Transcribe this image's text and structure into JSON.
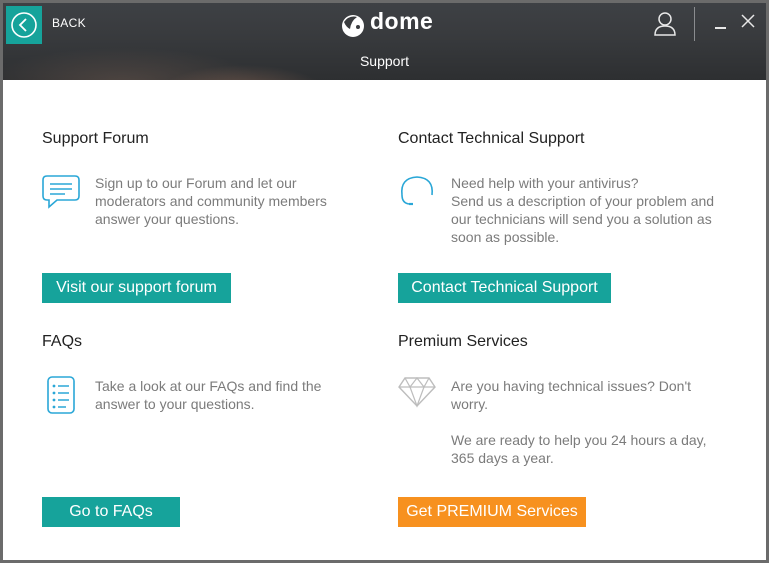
{
  "header": {
    "back_label": "BACK",
    "logo_text": "dome",
    "page_title": "Support"
  },
  "sections": {
    "forum": {
      "title": "Support Forum",
      "description": "Sign up to our Forum and let our moderators and community members answer your questions.",
      "button_label": "Visit our support forum",
      "icon": "chat-bubble-icon"
    },
    "contact": {
      "title": "Contact Technical Support",
      "description_line1": "Need help with your antivirus?",
      "description_line2": "Send us a description of your problem and our technicians will send you a solution as soon as possible.",
      "button_label": "Contact Technical Support",
      "icon": "headset-icon"
    },
    "faqs": {
      "title": "FAQs",
      "description": "Take a look at our FAQs and find the answer to your questions.",
      "button_label": "Go to FAQs",
      "icon": "faq-list-icon"
    },
    "premium": {
      "title": "Premium Services",
      "description_line1": "Are you having technical issues? Don't worry.",
      "description_line2": "We are ready to help you 24 hours a day, 365 days a year.",
      "button_label": "Get PREMIUM Services",
      "icon": "diamond-icon"
    }
  },
  "colors": {
    "accent_teal": "#16a39b",
    "premium_orange": "#f7911f",
    "icon_blue": "#2aa7d7"
  }
}
